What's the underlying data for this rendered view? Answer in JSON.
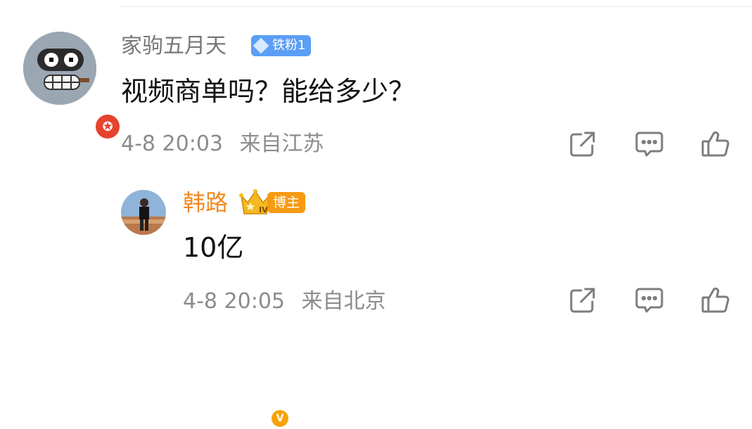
{
  "comment": {
    "username": "家驹五月天",
    "fan_badge": "铁粉1",
    "text": "视频商单吗？能给多少？",
    "timestamp": "4-8 20:03",
    "location": "来自江苏"
  },
  "reply": {
    "username": "韩路",
    "crown_level": "IV",
    "role_badge": "博主",
    "text": "10亿",
    "timestamp": "4-8 20:05",
    "location": "来自北京"
  },
  "colors": {
    "fan_badge_bg": "#5b9ef5",
    "blogger_name": "#f08a1d",
    "blogger_badge_bg": "#f79a14",
    "meta_text": "#8c8c8c"
  }
}
